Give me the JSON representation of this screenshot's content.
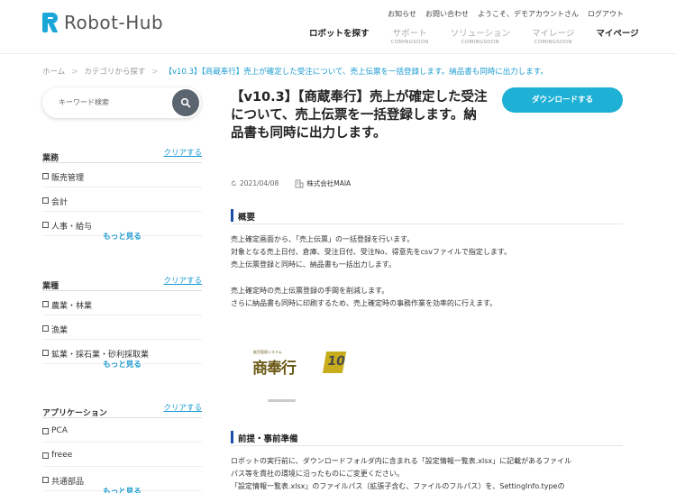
{
  "brand": {
    "name": "Robot-Hub"
  },
  "topnav": [
    "お知らせ",
    "お問い合わせ",
    "ようこそ、デモアカウントさん",
    "ログアウト"
  ],
  "mainnav": [
    {
      "label": "ロボットを探す",
      "sub": ""
    },
    {
      "label": "サポート",
      "sub": "COMINGSOON"
    },
    {
      "label": "ソリューション",
      "sub": "COMINGSOON"
    },
    {
      "label": "マイレージ",
      "sub": "COMINGSOON"
    },
    {
      "label": "マイページ",
      "sub": ""
    }
  ],
  "breadcrumb": [
    "ホーム",
    "カテゴリから探す",
    "【v10.3】【商蔵奉行】売上が確定した受注について、売上伝票を一括登録します。納品書も同時に出力します。"
  ],
  "search": {
    "placeholder": "キーワード検索"
  },
  "filters": [
    {
      "title": "業務",
      "clear": "クリアする",
      "options": [
        "販売管理",
        "会計",
        "人事・給与"
      ],
      "more": "もっと見る"
    },
    {
      "title": "業種",
      "clear": "クリアする",
      "options": [
        "農業・林業",
        "漁業",
        "鉱業・採石業・砂利採取業"
      ],
      "more": "もっと見る"
    },
    {
      "title": "アプリケーション",
      "clear": "クリアする",
      "options": [
        "PCA",
        "freee",
        "共通部品"
      ],
      "more": "もっと見る"
    }
  ],
  "product": {
    "title": "【v10.3】【商蔵奉行】売上が確定した受注について、売上伝票を一括登録します。納品書も同時に出力します。",
    "download": "ダウンロードする",
    "date": "2021/04/08",
    "company": "株式会社MAIA"
  },
  "overview": {
    "heading": "概要",
    "lines1": [
      "売上確定画面から、「売上伝票」の一括登録を行います。",
      "対象となる売上日付、倉庫、受注日付、受注No、得意先をcsvファイルで指定します。",
      "売上伝票登録と同時に、納品書も一括出力します。"
    ],
    "lines2": [
      "売上確定時の売上伝票登録の手間を削減します。",
      "さらに納品書も同時に印刷するため、売上確定時の事務作業を効率的に行えます。"
    ]
  },
  "product_logo": {
    "caption": "販売管理システム",
    "name": "商奉行",
    "version": "10"
  },
  "prereq": {
    "heading": "前提・事前準備",
    "lines": [
      "ロボットの実行前に、ダウンロードフォルダ内に含まれる「設定情報一覧表.xlsx」に記載があるファイル",
      "パス等を貴社の環境に沿ったものにご変更ください。",
      "「設定情報一覧表.xlsx」のファイルパス（拡張子含む、ファイルのフルパス）を、SettingInfo.typeの"
    ]
  }
}
